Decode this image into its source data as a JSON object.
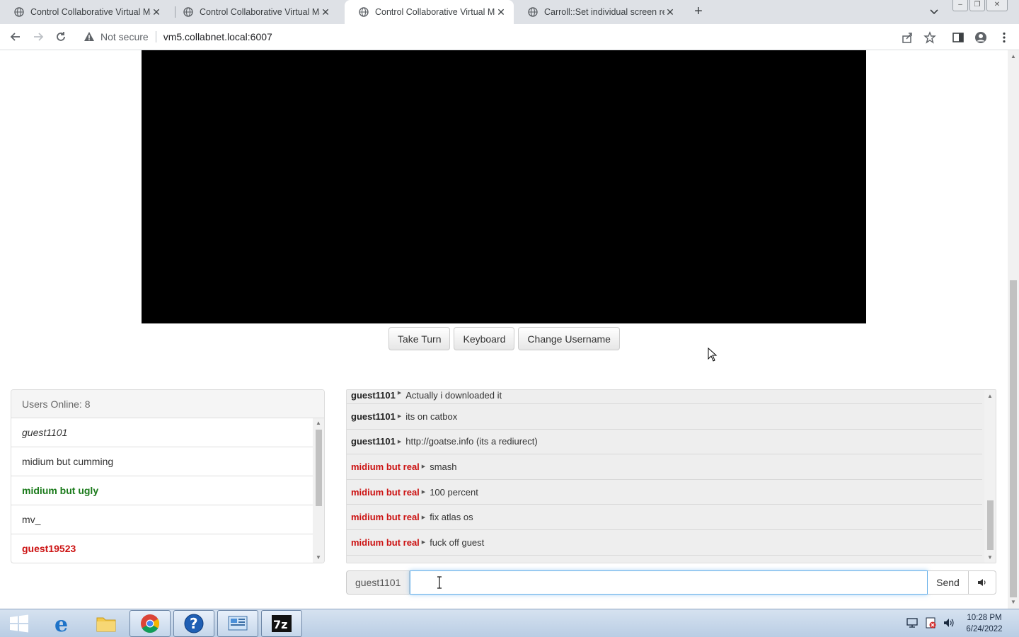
{
  "browser": {
    "tabs": [
      {
        "title": "Control Collaborative Virtual Ma",
        "active": false
      },
      {
        "title": "Control Collaborative Virtual Ma",
        "active": false
      },
      {
        "title": "Control Collaborative Virtual Ma",
        "active": true
      },
      {
        "title": "Carroll::Set individual screen reso",
        "active": false
      }
    ],
    "new_tab_label": "+",
    "security_label": "Not secure",
    "url": "vm5.collabnet.local:6007"
  },
  "vm": {
    "buttons": {
      "take_turn": "Take Turn",
      "keyboard": "Keyboard",
      "change_username": "Change Username"
    }
  },
  "users": {
    "header": "Users Online: 8",
    "list": [
      {
        "name": "guest1101",
        "style": "italic"
      },
      {
        "name": "midium but cumming",
        "style": "normal"
      },
      {
        "name": "midium but ugly",
        "style": "green"
      },
      {
        "name": "mv_",
        "style": "normal"
      },
      {
        "name": "guest19523",
        "style": "red"
      }
    ]
  },
  "chat": {
    "messages": [
      {
        "user": "guest1101",
        "text": "Actually i downloaded it",
        "color": "black"
      },
      {
        "user": "guest1101",
        "text": "its on catbox",
        "color": "black"
      },
      {
        "user": "guest1101",
        "text": "http://goatse.info (its a rediurect)",
        "color": "black"
      },
      {
        "user": "midium but real",
        "text": "smash",
        "color": "red"
      },
      {
        "user": "midium but real",
        "text": "100 percent",
        "color": "red"
      },
      {
        "user": "midium but real",
        "text": "fix atlas os",
        "color": "red"
      },
      {
        "user": "midium but real",
        "text": "fuck off guest",
        "color": "red"
      }
    ],
    "input": {
      "username": "guest1101",
      "value": "",
      "send_label": "Send"
    }
  },
  "taskbar": {
    "apps": [
      "start-button",
      "edge",
      "file-explorer",
      "chrome",
      "help",
      "control-panel",
      "7zip"
    ],
    "clock": {
      "time": "10:28 PM",
      "date": "6/24/2022"
    }
  },
  "colors": {
    "red_user": "#cc1111",
    "green_user": "#1a7a1a",
    "input_focus": "#66afe9"
  }
}
